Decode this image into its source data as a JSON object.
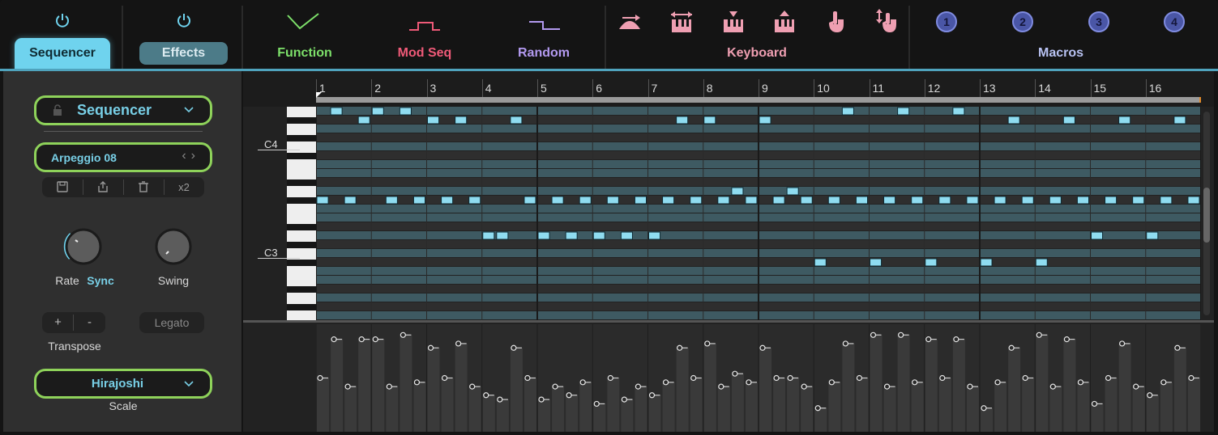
{
  "tabs": {
    "sequencer": "Sequencer",
    "effects": "Effects"
  },
  "modulators": [
    {
      "label": "Function",
      "color": "#7de06a"
    },
    {
      "label": "Mod Seq",
      "color": "#ef5a78"
    },
    {
      "label": "Random",
      "color": "#b39af0"
    }
  ],
  "keyboard": {
    "label": "Keyboard",
    "color": "#ef9fb2",
    "icons": [
      "velocity-icon",
      "aftertouch-icon",
      "keytrack-icon",
      "note-icon",
      "touch-icon",
      "release-icon"
    ]
  },
  "macros": {
    "label": "Macros",
    "color": "#b8c2f2",
    "items": [
      "1",
      "2",
      "3",
      "4"
    ]
  },
  "left_panel": {
    "mode_select": "Sequencer",
    "preset": "Arpeggio 08",
    "preset_tools": {
      "x2": "x2"
    },
    "rate_label": "Rate",
    "rate_value": "Sync",
    "swing_label": "Swing",
    "transpose_plus": "+",
    "transpose_minus": "-",
    "transpose_label": "Transpose",
    "legato": "Legato",
    "scale_select": "Hirajoshi",
    "scale_label": "Scale"
  },
  "ruler": {
    "steps": [
      "1",
      "2",
      "3",
      "4",
      "5",
      "6",
      "7",
      "8",
      "9",
      "10",
      "11",
      "12",
      "13",
      "14",
      "15",
      "16"
    ]
  },
  "piano": {
    "labels": [
      "C4",
      "C3"
    ]
  },
  "sequence": {
    "steps_per_bar": 4,
    "notes": [
      {
        "step": 1,
        "row": 10
      },
      {
        "step": 2,
        "row": 0
      },
      {
        "step": 3,
        "row": 10
      },
      {
        "step": 4,
        "row": 1
      },
      {
        "step": 5,
        "row": 0
      },
      {
        "step": 6,
        "row": 10
      },
      {
        "step": 7,
        "row": 0
      },
      {
        "step": 8,
        "row": 10
      },
      {
        "step": 9,
        "row": 1
      },
      {
        "step": 10,
        "row": 10
      },
      {
        "step": 11,
        "row": 1
      },
      {
        "step": 12,
        "row": 10
      },
      {
        "step": 13,
        "row": 14
      },
      {
        "step": 14,
        "row": 14
      },
      {
        "step": 15,
        "row": 1
      },
      {
        "step": 16,
        "row": 10
      },
      {
        "step": 17,
        "row": 14
      },
      {
        "step": 18,
        "row": 10
      },
      {
        "step": 19,
        "row": 14
      },
      {
        "step": 20,
        "row": 10
      },
      {
        "step": 21,
        "row": 14
      },
      {
        "step": 22,
        "row": 10
      },
      {
        "step": 23,
        "row": 14
      },
      {
        "step": 24,
        "row": 10
      },
      {
        "step": 25,
        "row": 14
      },
      {
        "step": 26,
        "row": 10
      },
      {
        "step": 27,
        "row": 1
      },
      {
        "step": 28,
        "row": 10
      },
      {
        "step": 29,
        "row": 1
      },
      {
        "step": 30,
        "row": 10
      },
      {
        "step": 31,
        "row": 9
      },
      {
        "step": 32,
        "row": 10
      },
      {
        "step": 33,
        "row": 1
      },
      {
        "step": 34,
        "row": 10
      },
      {
        "step": 35,
        "row": 9
      },
      {
        "step": 36,
        "row": 10
      },
      {
        "step": 37,
        "row": 17
      },
      {
        "step": 38,
        "row": 10
      },
      {
        "step": 39,
        "row": 0
      },
      {
        "step": 40,
        "row": 10
      },
      {
        "step": 41,
        "row": 17
      },
      {
        "step": 42,
        "row": 10
      },
      {
        "step": 43,
        "row": 0
      },
      {
        "step": 44,
        "row": 10
      },
      {
        "step": 45,
        "row": 17
      },
      {
        "step": 46,
        "row": 10
      },
      {
        "step": 47,
        "row": 0
      },
      {
        "step": 48,
        "row": 10
      },
      {
        "step": 49,
        "row": 17
      },
      {
        "step": 50,
        "row": 10
      },
      {
        "step": 51,
        "row": 1
      },
      {
        "step": 52,
        "row": 10
      },
      {
        "step": 53,
        "row": 17
      },
      {
        "step": 54,
        "row": 10
      },
      {
        "step": 55,
        "row": 1
      },
      {
        "step": 56,
        "row": 10
      },
      {
        "step": 57,
        "row": 14
      },
      {
        "step": 58,
        "row": 10
      },
      {
        "step": 59,
        "row": 1
      },
      {
        "step": 60,
        "row": 10
      },
      {
        "step": 61,
        "row": 14
      },
      {
        "step": 62,
        "row": 10
      },
      {
        "step": 63,
        "row": 1
      },
      {
        "step": 64,
        "row": 10
      }
    ]
  },
  "colors": {
    "accent": "#6fd3ee",
    "note_fill": "#8fdcf0",
    "row_light": "#3e5a62",
    "row_dark": "#2e2e2e",
    "green_ring": "#8ed25a"
  }
}
